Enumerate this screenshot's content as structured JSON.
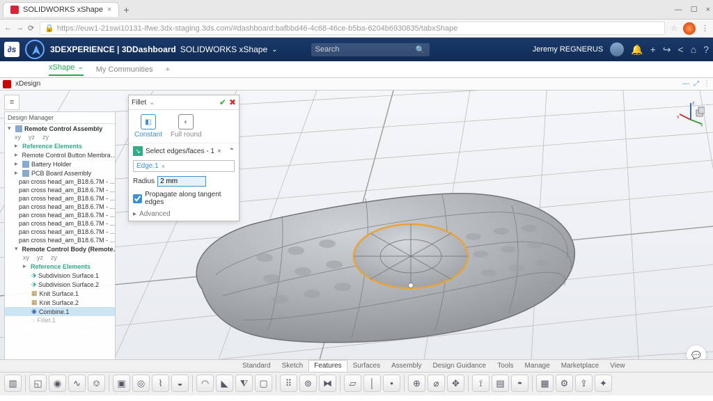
{
  "chrome": {
    "tab_title": "SOLIDWORKS xShape",
    "url": "https://euw1-21swi10131-ifwe.3dx-staging.3ds.com/#dashboard:bafbbd46-4c68-46ce-b5ba-6204b6930835/tabxShape"
  },
  "header": {
    "brand": "3DEXPERIENCE | 3DDashboard",
    "app": "SOLIDWORKS xShape",
    "search_placeholder": "Search",
    "user": "Jeremy REGNERUS"
  },
  "tabs": {
    "active": "xShape",
    "inactive": "My Communities"
  },
  "xdesign": "xDesign",
  "design_manager": {
    "title": "Design Manager",
    "root": "Remote Control Assembly",
    "axes": [
      "xy",
      "yz",
      "zy"
    ],
    "ref": "Reference Elements",
    "items": [
      "Remote Control Button Membra…",
      "Battery Holder",
      "PCB Board Assembly",
      "pan cross head_am_B18.6.7M - …",
      "pan cross head_am_B18.6.7M - …",
      "pan cross head_am_B18.6.7M - …",
      "pan cross head_am_B18.6.7M - …",
      "pan cross head_am_B18.6.7M - …",
      "pan cross head_am_B18.6.7M - …",
      "pan cross head_am_B18.6.7M - …",
      "pan cross head_am_B18.6.7M - …"
    ],
    "body_item": "Remote Control Body (Remote…",
    "ref2": "Reference Elements",
    "sub1": "Subdivision Surface.1",
    "sub2": "Subdivision Surface.2",
    "knit1": "Knit Surface.1",
    "knit2": "Knit Surface.2",
    "combine": "Combine.1",
    "fillet_item": "Fillet.1"
  },
  "fillet": {
    "title": "Fillet",
    "type_constant": "Constant",
    "type_full": "Full round",
    "select_label": "Select edges/faces - 1",
    "edge_chip": "Edge.1",
    "radius_label": "Radius",
    "radius_value": "2 mm",
    "propagate": "Propagate along tangent edges",
    "advanced": "Advanced"
  },
  "ribbon": {
    "tabs": [
      "Standard",
      "Sketch",
      "Features",
      "Surfaces",
      "Assembly",
      "Design Guidance",
      "Tools",
      "Manage",
      "Marketplace",
      "View"
    ],
    "active": "Features"
  }
}
